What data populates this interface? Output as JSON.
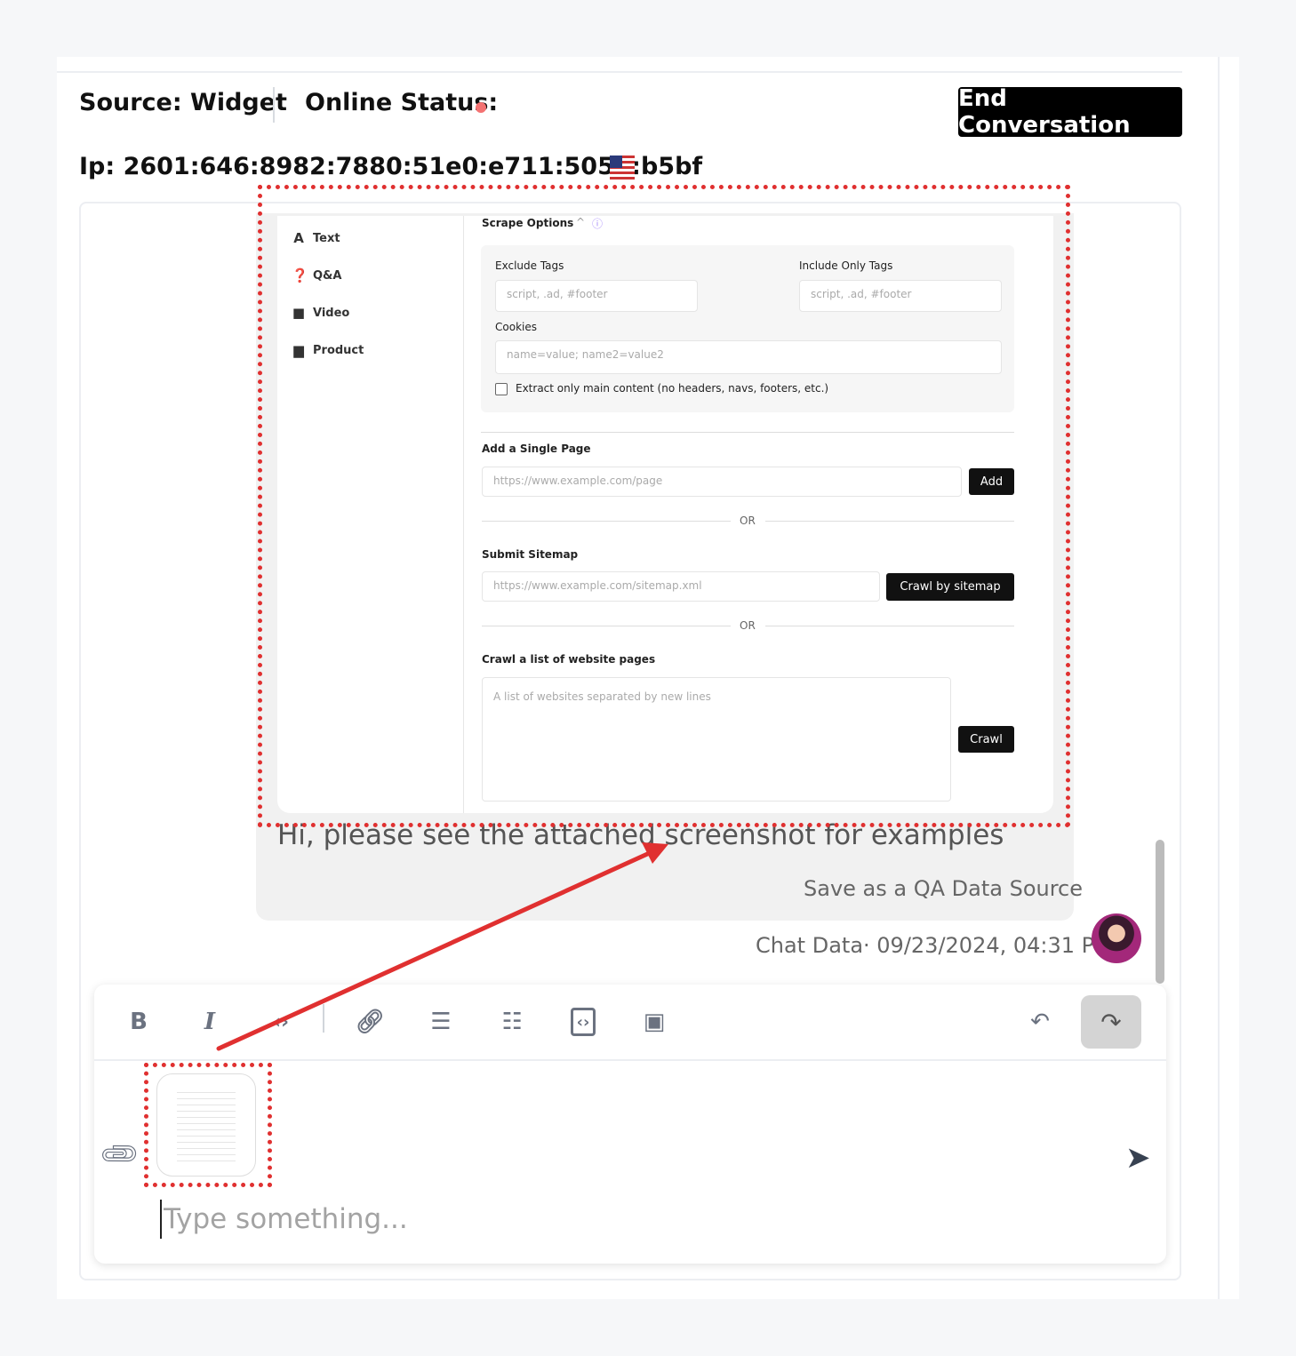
{
  "header": {
    "source": "Source: Widget",
    "online_status": "Online Status:",
    "ip": "Ip: 2601:646:8982:7880:51e0:e711:505b:b5bf",
    "end_button": "End Conversation",
    "status_color": "#f47272"
  },
  "attachment_screenshot": {
    "sidebar": [
      {
        "icon": "text-icon",
        "label": "Text"
      },
      {
        "icon": "question-icon",
        "label": "Q&A"
      },
      {
        "icon": "video-icon",
        "label": "Video"
      },
      {
        "icon": "product-icon",
        "label": "Product"
      }
    ],
    "scrape_options": "Scrape Options",
    "exclude_tags_label": "Exclude Tags",
    "exclude_tags_placeholder": "script, .ad, #footer",
    "include_tags_label": "Include Only Tags",
    "include_tags_placeholder": "script, .ad, #footer",
    "cookies_label": "Cookies",
    "cookies_placeholder": "name=value; name2=value2",
    "extract_label": "Extract only main content (no headers, navs, footers, etc.)",
    "single_page_label": "Add a Single Page",
    "single_page_placeholder": "https://www.example.com/page",
    "add_button": "Add",
    "or": "OR",
    "sitemap_label": "Submit Sitemap",
    "sitemap_placeholder": "https://www.example.com/sitemap.xml",
    "sitemap_button": "Crawl by sitemap",
    "crawl_list_label": "Crawl a list of website pages",
    "crawl_list_placeholder": "A list of websites separated by new lines",
    "crawl_button": "Crawl"
  },
  "message": {
    "text": "Hi, please see the attached screenshot for examples",
    "save_link": "Save as a QA Data Source",
    "timestamp": "Chat Data· 09/23/2024, 04:31 PM"
  },
  "editor": {
    "placeholder": "Type something...",
    "toolbar": [
      "bold",
      "italic",
      "code",
      "link",
      "bullet-list",
      "ordered-list",
      "code-block",
      "image",
      "undo",
      "redo"
    ]
  },
  "annotation_color": "#e03030"
}
